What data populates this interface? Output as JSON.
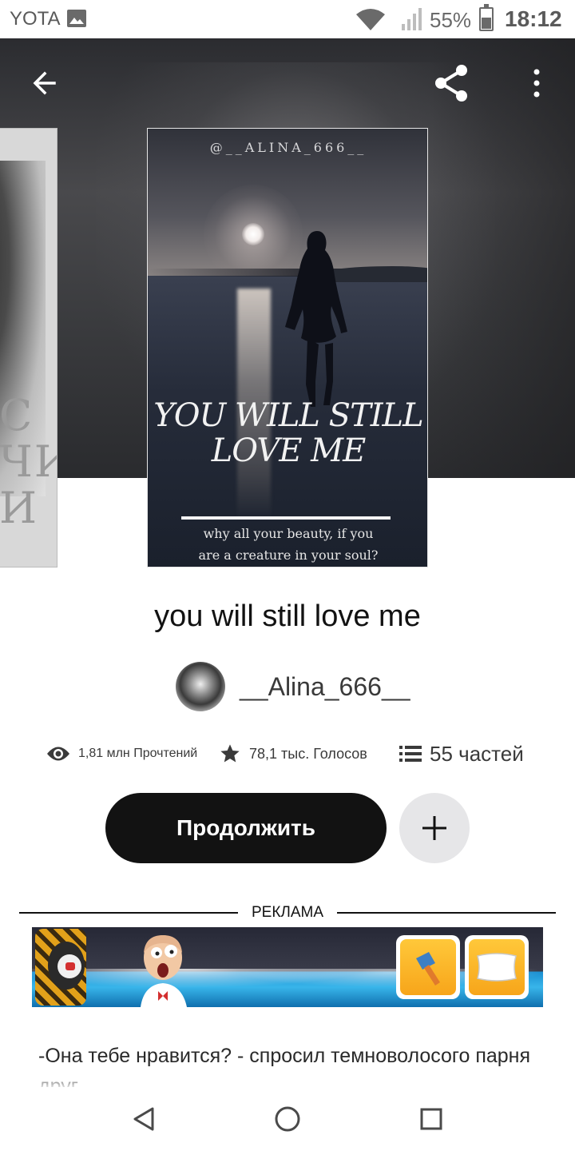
{
  "status_bar": {
    "carrier": "YOTA",
    "battery_percent": "55%",
    "time": "18:12",
    "icons": [
      "gallery-icon",
      "wifi-icon",
      "signal-icon",
      "battery-icon"
    ]
  },
  "header": {
    "back_icon": "arrow-left-icon",
    "share_icon": "share-icon",
    "more_icon": "more-vertical-icon"
  },
  "side_cover": {
    "visible_text": [
      "С",
      "ЧИ",
      "И"
    ]
  },
  "cover": {
    "handle": "@__ALINA_666__",
    "title_line1": "YOU WILL STILL",
    "title_line2": "LOVE ME",
    "tagline_line1": "why all your beauty, if you",
    "tagline_line2": "are a creature in your soul?"
  },
  "book": {
    "title": "you will still love me",
    "author": "__Alina_666__"
  },
  "stats": {
    "reads": "1,81 млн Прочтений",
    "votes": "78,1 тыс. Голосов",
    "parts": "55 частей",
    "icons": [
      "eye-icon",
      "star-icon",
      "list-icon"
    ]
  },
  "actions": {
    "continue_label": "Продолжить",
    "add_icon": "plus-icon"
  },
  "ad": {
    "label": "РЕКЛАМА",
    "tiles": [
      "hammer-icon",
      "pillow-icon"
    ]
  },
  "excerpt": {
    "text": "-Она тебе нравится? - спросил темноволосого парня друг."
  },
  "nav": {
    "icons": [
      "nav-back-icon",
      "nav-home-icon",
      "nav-recent-icon"
    ]
  },
  "colors": {
    "primary_button": "#121212",
    "add_button": "#e6e6e8",
    "text": "#121212",
    "muted_text": "#3a3a3a"
  }
}
